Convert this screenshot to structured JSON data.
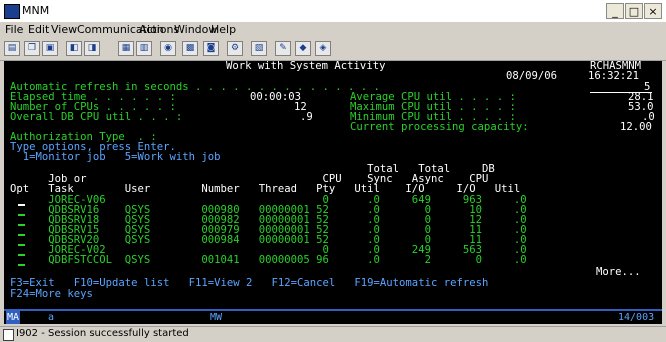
{
  "window": {
    "title": "MNM",
    "min_label": "_",
    "max_label": "□",
    "close_label": "×"
  },
  "menu": [
    "File",
    "Edit",
    "View",
    "Communication",
    "Actions",
    "Window",
    "Help"
  ],
  "screen": {
    "title": "Work with System Activity",
    "system": "RCHASMNM",
    "date": "08/09/06",
    "time": "16:32:21",
    "refresh_label": "Automatic refresh in seconds . . . . . . . . . . . . . . .",
    "refresh_value": "5",
    "elapsed_label": "Elapsed time . . . . . . :",
    "elapsed_value": "00:00:03",
    "cpus_label": "Number of CPUs . . . . . :",
    "cpus_value": "12",
    "db_label": "Overall DB CPU util . . . :",
    "db_value": ".9",
    "avg_label": "Average CPU util . . . . :",
    "avg_value": "28.1",
    "max_label": "Maximum CPU util . . . . :",
    "max_value": "53.0",
    "min_label": "Minimum CPU util . . . . :",
    "min_value": ".0",
    "capacity_label": "Current processing capacity:",
    "capacity_value": "12.00",
    "auth_label": "Authorization Type  . :",
    "options_label": "Type options, press Enter.",
    "options_line": "  1=Monitor job   5=Work with job",
    "headers1": "                                                        Total   Total     DB",
    "headers2": "      Job or                                     CPU    Sync   Async    CPU",
    "headers3": "Opt   Task        User        Number   Thread   Pty   Util    I/O     I/O   Util",
    "rows": [
      "      JOREC-V06                                  0      .0     649     963     .0",
      "      QDBSRV16    QSYS        000980   00000001 52      .0       0      10     .0",
      "      QDBSRV18    QSYS        000982   00000001 52      .0       0      12     .0",
      "      QDBSRV15    QSYS        000979   00000001 52      .0       0      11     .0",
      "      QDBSRV20    QSYS        000984   00000001 52      .0       0      11     .0",
      "      JOREC-V02                                  0      .0     249     563     .0",
      "      QDBFSTCCOL  QSYS        001041   00000005 96      .0       2       0     .0"
    ],
    "more": "More...",
    "fkeys1": "F3=Exit   F10=Update list   F11=View 2   F12=Cancel   F19=Automatic refresh",
    "fkeys2": "F24=More keys"
  },
  "oia": {
    "left": "MA",
    "mode": "a",
    "mw": "MW",
    "position": "14/003"
  },
  "status": {
    "message": "I902 - Session successfully started"
  }
}
